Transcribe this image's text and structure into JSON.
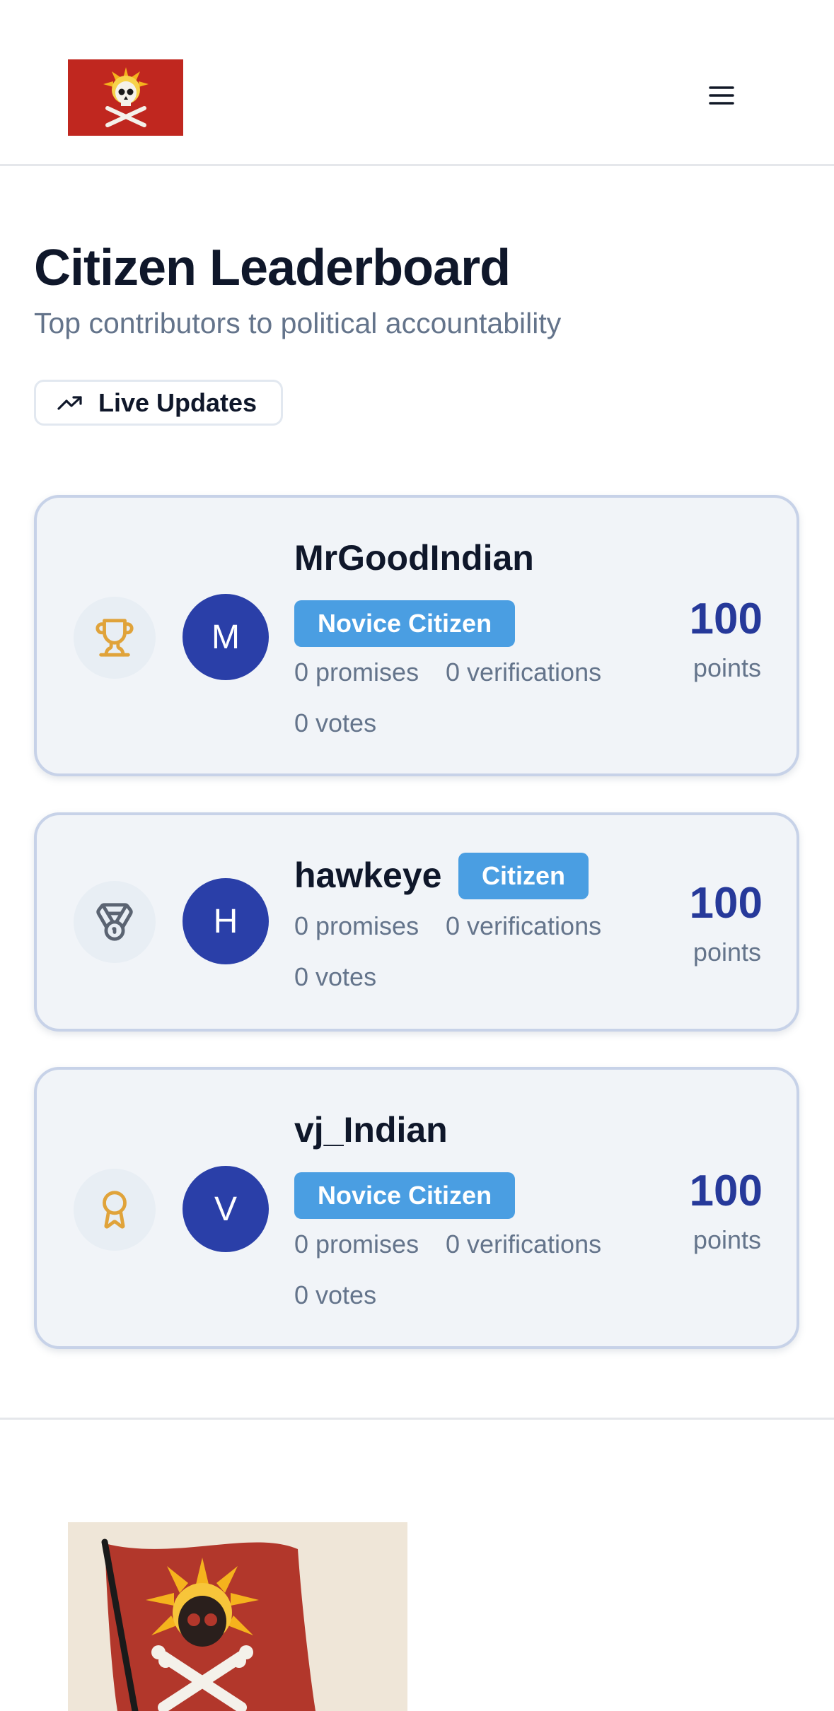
{
  "header": {
    "logo_icon": "skull-crossbones-flag-icon",
    "menu_icon": "hamburger-menu-icon"
  },
  "page": {
    "title": "Citizen Leaderboard",
    "subtitle": "Top contributors to political accountability",
    "live_badge": "Live Updates",
    "live_icon": "trending-up-icon"
  },
  "leaderboard": [
    {
      "rank_icon": "trophy-icon",
      "avatar_letter": "M",
      "name": "MrGoodIndian",
      "level": "Novice Citizen",
      "promises": "0 promises",
      "verifications": "0 verifications",
      "votes": "0 votes",
      "points": "100",
      "points_label": "points"
    },
    {
      "rank_icon": "medal-icon",
      "avatar_letter": "H",
      "name": "hawkeye",
      "level": "Citizen",
      "promises": "0 promises",
      "verifications": "0 verifications",
      "votes": "0 votes",
      "points": "100",
      "points_label": "points"
    },
    {
      "rank_icon": "award-ribbon-icon",
      "avatar_letter": "V",
      "name": "vj_Indian",
      "level": "Novice Citizen",
      "promises": "0 promises",
      "verifications": "0 verifications",
      "votes": "0 votes",
      "points": "100",
      "points_label": "points"
    }
  ],
  "colors": {
    "accent_blue": "#26399a",
    "avatar_blue": "#2a3fa8",
    "badge_blue": "#4a9ee2",
    "gold": "#e0a33a",
    "silver": "#5b6472",
    "flag_red": "#c0271f"
  },
  "footer": {
    "logo_icon": "skull-crossbones-flag-icon"
  }
}
